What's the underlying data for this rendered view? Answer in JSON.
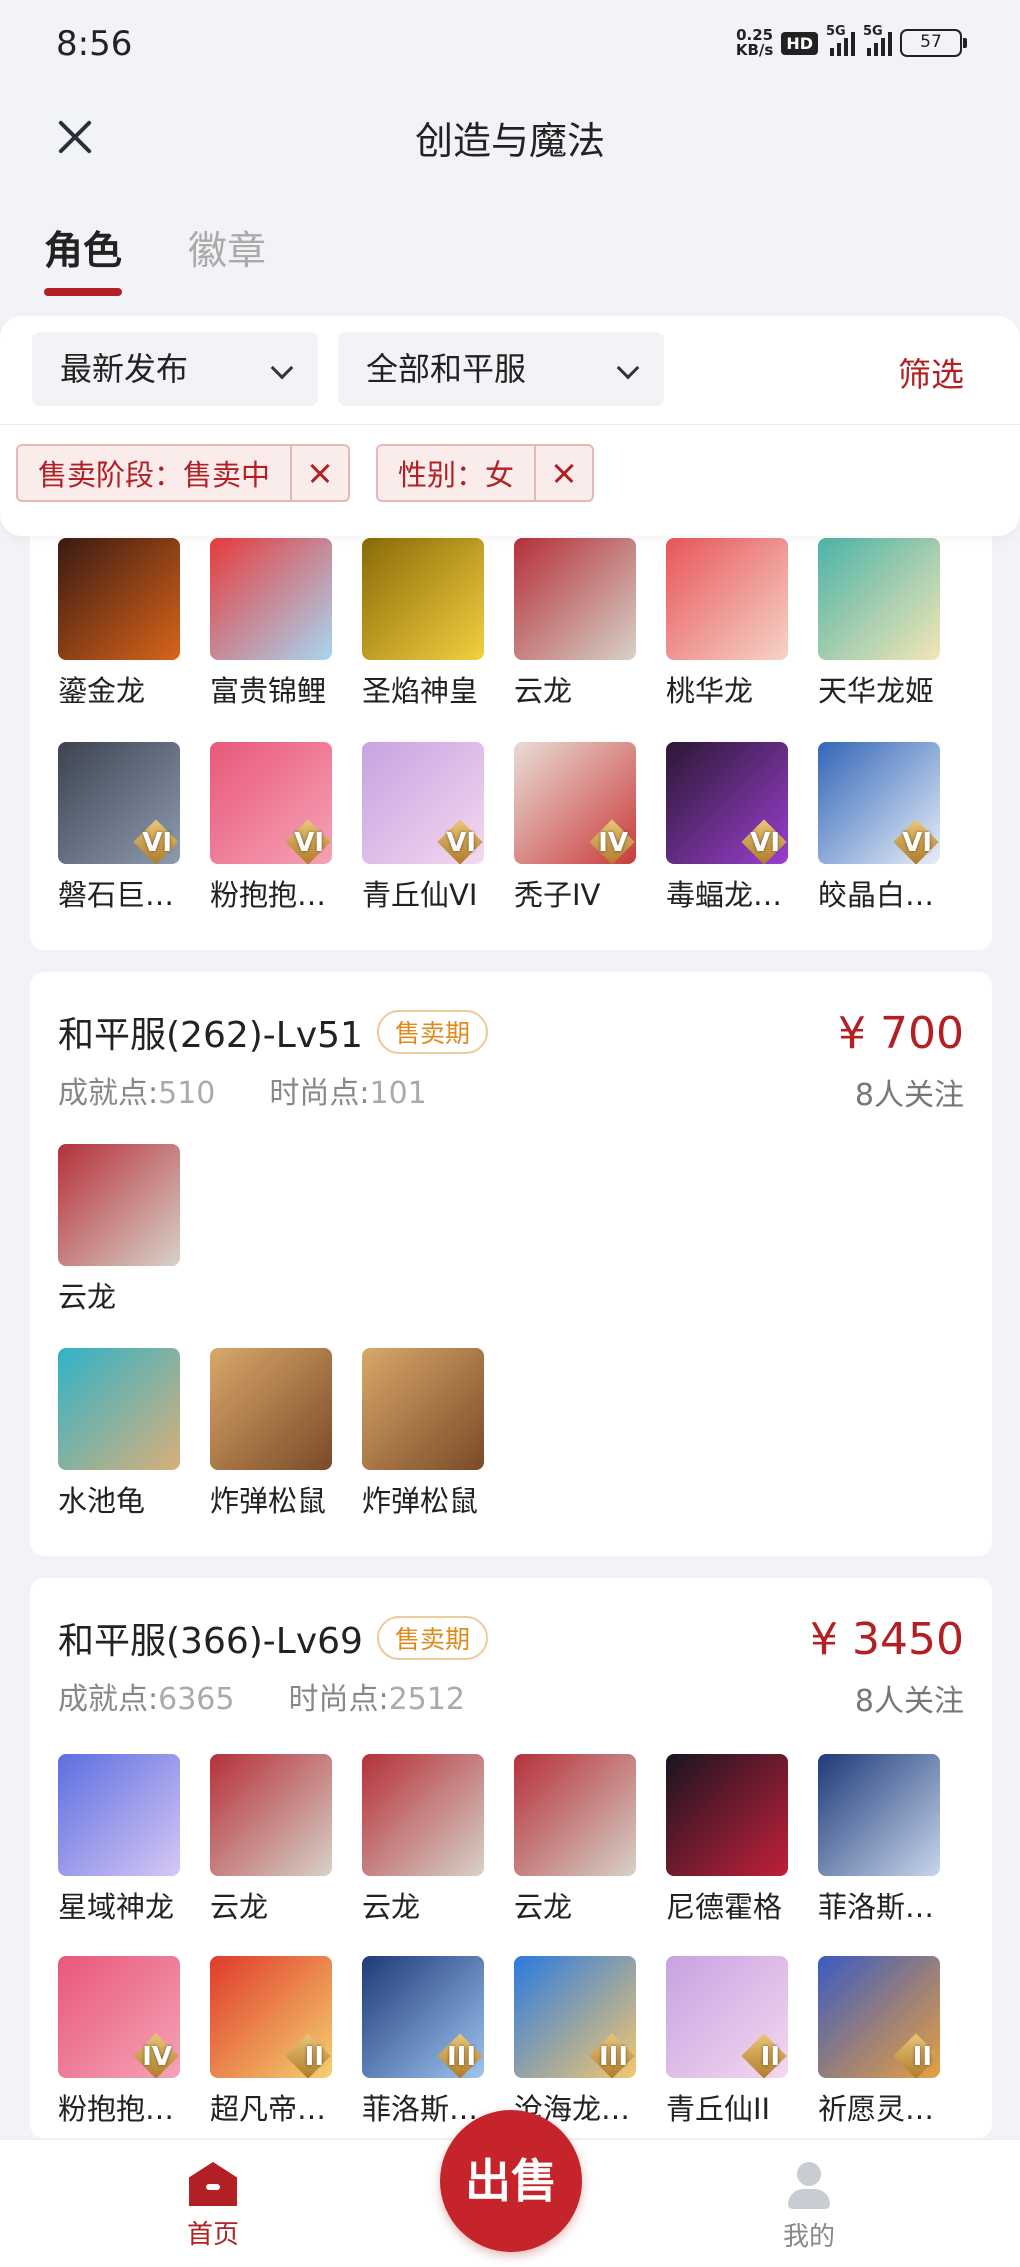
{
  "status": {
    "time": "8:56",
    "net_speed": "0.25",
    "net_unit": "KB/s",
    "hd": "HD",
    "sim1": "5G",
    "sim2": "5G",
    "battery": "57"
  },
  "header": {
    "title": "创造与魔法",
    "close": "×"
  },
  "tabs": [
    {
      "label": "角色"
    },
    {
      "label": "徽章"
    }
  ],
  "filters": {
    "sort": "最新发布",
    "server": "全部和平服",
    "filter_label": "筛选",
    "chips": [
      {
        "label": "售卖阶段：售卖中"
      },
      {
        "label": "性别：女"
      }
    ]
  },
  "card0": {
    "row1": [
      {
        "name": "鎏金龙",
        "c1": "#3a1a12",
        "c2": "#d8641a"
      },
      {
        "name": "富贵锦鲤",
        "c1": "#e63b3b",
        "c2": "#a8d6f2"
      },
      {
        "name": "圣焰神皇",
        "c1": "#8a6a08",
        "c2": "#f2d040"
      },
      {
        "name": "云龙",
        "c1": "#b5303a",
        "c2": "#d8d2c8"
      },
      {
        "name": "桃华龙",
        "c1": "#e8555a",
        "c2": "#f6d4c8"
      },
      {
        "name": "天华龙姬",
        "c1": "#4bb3a8",
        "c2": "#f3e6b6"
      }
    ],
    "row2": [
      {
        "name": "磐石巨…",
        "rank": "VI",
        "c1": "#3c4350",
        "c2": "#8e9cb0"
      },
      {
        "name": "粉抱抱…",
        "rank": "VI",
        "c1": "#e8587a",
        "c2": "#f5a3b6"
      },
      {
        "name": "青丘仙VI",
        "rank": "VI",
        "c1": "#c7a2e2",
        "c2": "#f4d8ef"
      },
      {
        "name": "秃子IV",
        "rank": "IV",
        "c1": "#e8ddd6",
        "c2": "#c93b3b"
      },
      {
        "name": "毒蝠龙…",
        "rank": "VI",
        "c1": "#2a1832",
        "c2": "#9a3fd0"
      },
      {
        "name": "皎晶白…",
        "rank": "VI",
        "c1": "#3266b8",
        "c2": "#e8eef8"
      }
    ]
  },
  "card1": {
    "title": "和平服(262)-Lv51",
    "badge": "售卖期",
    "achieve_label": "成就点:",
    "achieve_value": "510",
    "fashion_label": "时尚点:",
    "fashion_value": "101",
    "price": "¥ 700",
    "followers": "8人关注",
    "row1": [
      {
        "name": "云龙",
        "c1": "#b5303a",
        "c2": "#d8d2c8"
      }
    ],
    "row2": [
      {
        "name": "水池龟",
        "c1": "#2fb3c8",
        "c2": "#d8b07a"
      },
      {
        "name": "炸弹松鼠",
        "c1": "#d9a86a",
        "c2": "#7a4a28"
      },
      {
        "name": "炸弹松鼠",
        "c1": "#d9a86a",
        "c2": "#7a4a28"
      }
    ]
  },
  "card2": {
    "title": "和平服(366)-Lv69",
    "badge": "售卖期",
    "achieve_label": "成就点:",
    "achieve_value": "6365",
    "fashion_label": "时尚点:",
    "fashion_value": "2512",
    "price": "¥ 3450",
    "followers": "8人关注",
    "row1": [
      {
        "name": "星域神龙",
        "c1": "#5c6ee0",
        "c2": "#d6c8f4"
      },
      {
        "name": "云龙",
        "c1": "#b5303a",
        "c2": "#d8d2c8"
      },
      {
        "name": "云龙",
        "c1": "#b5303a",
        "c2": "#d8d2c8"
      },
      {
        "name": "云龙",
        "c1": "#b5303a",
        "c2": "#d8d2c8"
      },
      {
        "name": "尼德霍格",
        "c1": "#1a1420",
        "c2": "#c0203a"
      },
      {
        "name": "菲洛斯…",
        "c1": "#1e3a78",
        "c2": "#c8d6ec"
      }
    ],
    "row2": [
      {
        "name": "粉抱抱…",
        "rank": "IV",
        "c1": "#e8587a",
        "c2": "#f5a3b6"
      },
      {
        "name": "超凡帝…",
        "rank": "II",
        "c1": "#e03a2a",
        "c2": "#f4d070"
      },
      {
        "name": "菲洛斯…",
        "rank": "III",
        "c1": "#1e3a78",
        "c2": "#9ec4f0"
      },
      {
        "name": "沧海龙…",
        "rank": "III",
        "c1": "#2a7ae0",
        "c2": "#f4c870"
      },
      {
        "name": "青丘仙II",
        "rank": "II",
        "c1": "#c7a2e2",
        "c2": "#f4d8ef"
      },
      {
        "name": "祈愿灵…",
        "rank": "II",
        "c1": "#3a5ac0",
        "c2": "#e8a040"
      }
    ]
  },
  "nav": {
    "home": "首页",
    "sell": "出售",
    "me": "我的"
  }
}
